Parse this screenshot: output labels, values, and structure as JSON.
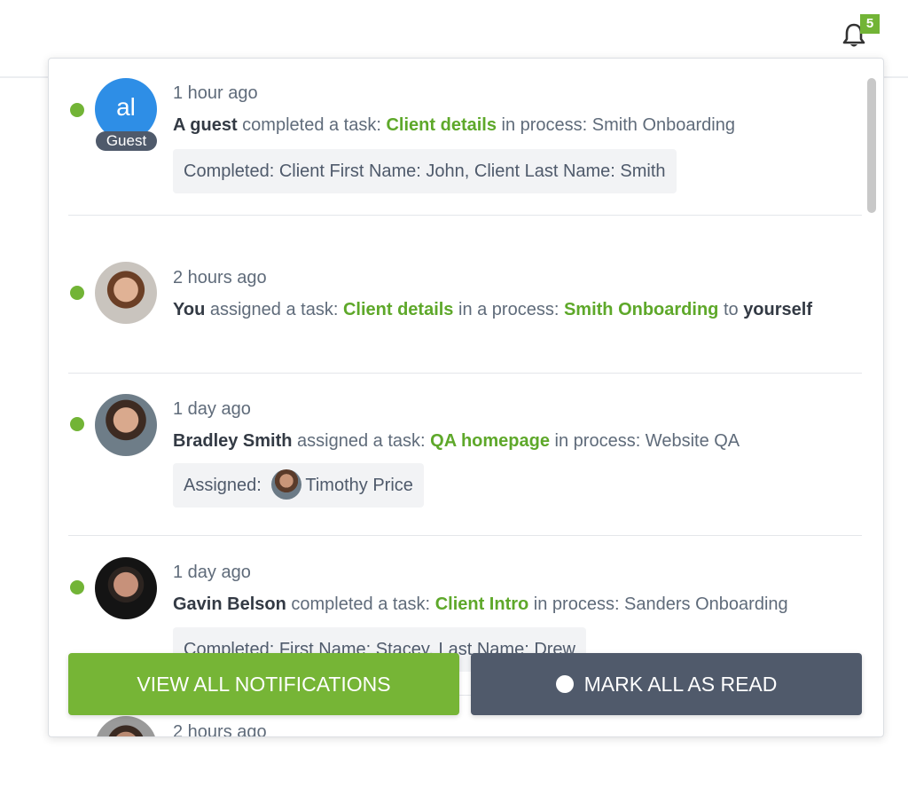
{
  "header": {
    "notification_count": "5",
    "bell_icon": "bell-icon"
  },
  "notifications": [
    {
      "time": "1 hour ago",
      "avatar": {
        "type": "initials",
        "initials": "al",
        "tag": "Guest",
        "color": "#2e8ee6"
      },
      "actor": "A guest",
      "action": " completed a task: ",
      "task": "Client details",
      "suffix": " in process: Smith Onboarding",
      "detail": "Completed:  Client First Name: John, Client Last Name: Smith",
      "unread": true
    },
    {
      "time": "2 hours ago",
      "avatar": {
        "type": "photo",
        "description": "man with short brown hair smiling"
      },
      "actor": "You",
      "action": " assigned a task: ",
      "task": "Client details",
      "middle": "  in a process: ",
      "process": "Smith Onboarding",
      "to": " to ",
      "target": "yourself",
      "unread": true
    },
    {
      "time": "1 day ago",
      "avatar": {
        "type": "photo",
        "description": "man with beard, dark background"
      },
      "actor": "Bradley Smith",
      "action": " assigned a task: ",
      "task": "QA homepage",
      "suffix": " in process: Website QA",
      "detail_label": "Assigned: ",
      "detail_person": "Timothy Price",
      "unread": true
    },
    {
      "time": "1 day ago",
      "avatar": {
        "type": "photo",
        "description": "man with short hair, black background"
      },
      "actor": "Gavin Belson",
      "action": " completed a task: ",
      "task": "Client Intro",
      "suffix": " in process: Sanders Onboarding",
      "detail": "Completed:  First Name: Stacey, Last Name: Drew",
      "unread": true
    },
    {
      "time": "2 hours ago",
      "avatar": {
        "type": "photo",
        "description": "partially visible man"
      },
      "unread": false
    }
  ],
  "buttons": {
    "view_all": "VIEW ALL NOTIFICATIONS",
    "mark_all_read": "MARK ALL AS READ"
  },
  "colors": {
    "accent_green": "#76b536",
    "dark_button": "#505a6b",
    "link_green": "#5ea82a",
    "guest_avatar": "#2e8ee6"
  }
}
